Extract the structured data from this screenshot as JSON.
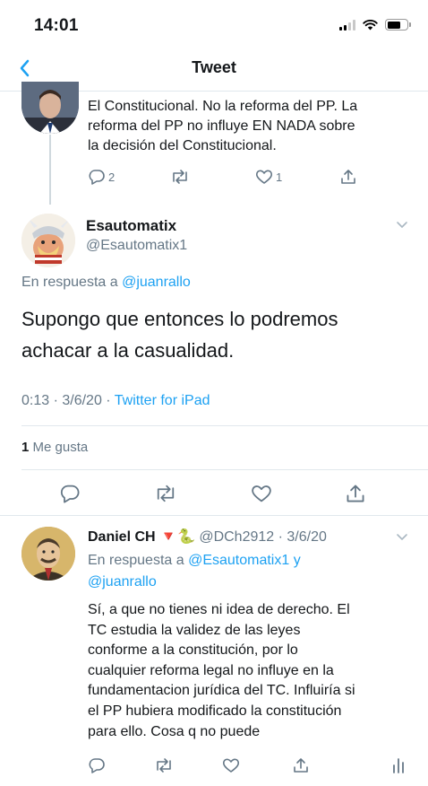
{
  "status_bar": {
    "time": "14:01"
  },
  "nav": {
    "title": "Tweet"
  },
  "previous_tweet": {
    "text_lines": [
      "El Constitucional. No la reforma del PP. La",
      "reforma del PP no influye EN NADA sobre",
      "la decisión del Constitucional."
    ],
    "reply_count": "2",
    "like_count": "1"
  },
  "main_tweet": {
    "name": "Esautomatix",
    "handle": "@Esautomatix1",
    "reply_prefix": "En respuesta a",
    "reply_to": "@juanrallo",
    "text_lines": [
      "Supongo que entonces lo podremos",
      "achacar a la casualidad."
    ],
    "timestamp": "0:13 · 3/6/20 · ",
    "source": "Twitter for iPad",
    "like_count": "1",
    "like_label": "Me gusta"
  },
  "reply_tweet": {
    "name": "Daniel CH",
    "emojis": "🔻🐍",
    "handle_date": "@DCh2912 · 3/6/20",
    "reply_prefix": "En respuesta a",
    "reply_to_1": "@Esautomatix1",
    "reply_joiner": "y",
    "reply_to_2": "@juanrallo",
    "text_lines": [
      "Sí, a que no tienes ni idea de derecho. El",
      "TC estudia la validez de las leyes",
      "conforme a la constitución, por lo",
      "cualquier reforma legal no influye en la",
      "fundamentacion jurídica del TC. Influiría si",
      "el PP hubiera modificado la constitución",
      "para ello. Cosa q no puede"
    ]
  },
  "colors": {
    "link": "#1da1f2",
    "secondary_text": "#657786",
    "divider": "#e1e8ed",
    "icon": "#657786"
  },
  "icons": [
    "back-chevron-icon",
    "signal-icon",
    "wifi-icon",
    "battery-icon",
    "reply-icon",
    "retweet-icon",
    "like-icon",
    "share-icon",
    "analytics-icon",
    "chevron-down-icon"
  ]
}
